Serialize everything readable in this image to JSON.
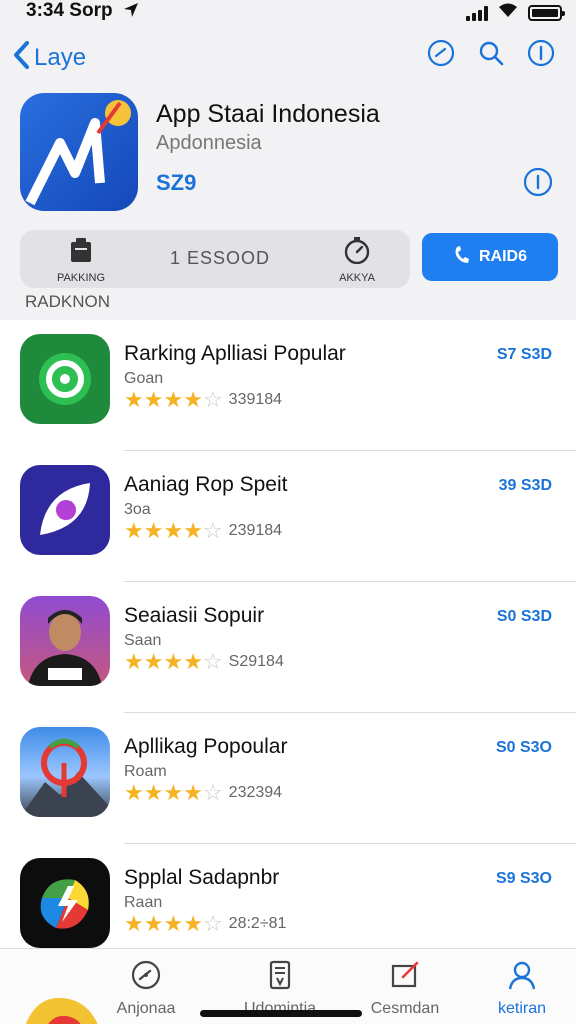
{
  "status": {
    "time": "3:34 Sorp"
  },
  "nav": {
    "back_label": "Laye"
  },
  "app": {
    "title": "App Staai Indonesia",
    "subtitle": "Apdonnesia",
    "price": "SZ9"
  },
  "segment": {
    "left_label": "PAKKING",
    "center_label": "1 ESSOOD",
    "right_label": "AKKYA"
  },
  "primary_button": {
    "label": "RAID6"
  },
  "section": {
    "title": "RADKNON"
  },
  "rows": [
    {
      "title": "Rarking Aplliasi Popular",
      "subtitle": "Goan",
      "rating": 4.5,
      "count": "339184",
      "price": "S7 S3D"
    },
    {
      "title": "Aaniag Rop Speit",
      "subtitle": "3oa",
      "rating": 4.5,
      "count": "239184",
      "price": "39 S3D"
    },
    {
      "title": "Seaiasii Sopuir",
      "subtitle": "Saan",
      "rating": 4.5,
      "count": "S29184",
      "price": "S0 S3D"
    },
    {
      "title": "Apllikag Popoular",
      "subtitle": "Roam",
      "rating": 4.5,
      "count": "232394",
      "price": "S0 S3O"
    },
    {
      "title": "Spplal Sadapnbr",
      "subtitle": "Raan",
      "rating": 4.5,
      "count": "28:2÷81",
      "price": "S9 S3O"
    }
  ],
  "tabs": [
    {
      "label": "Anjonaa"
    },
    {
      "label": "Udomintia"
    },
    {
      "label": "Cesmdan"
    },
    {
      "label": "ketiran"
    }
  ],
  "colors": {
    "accent": "#1a73d9",
    "button": "#1f7ff0",
    "star": "#f5b323"
  }
}
